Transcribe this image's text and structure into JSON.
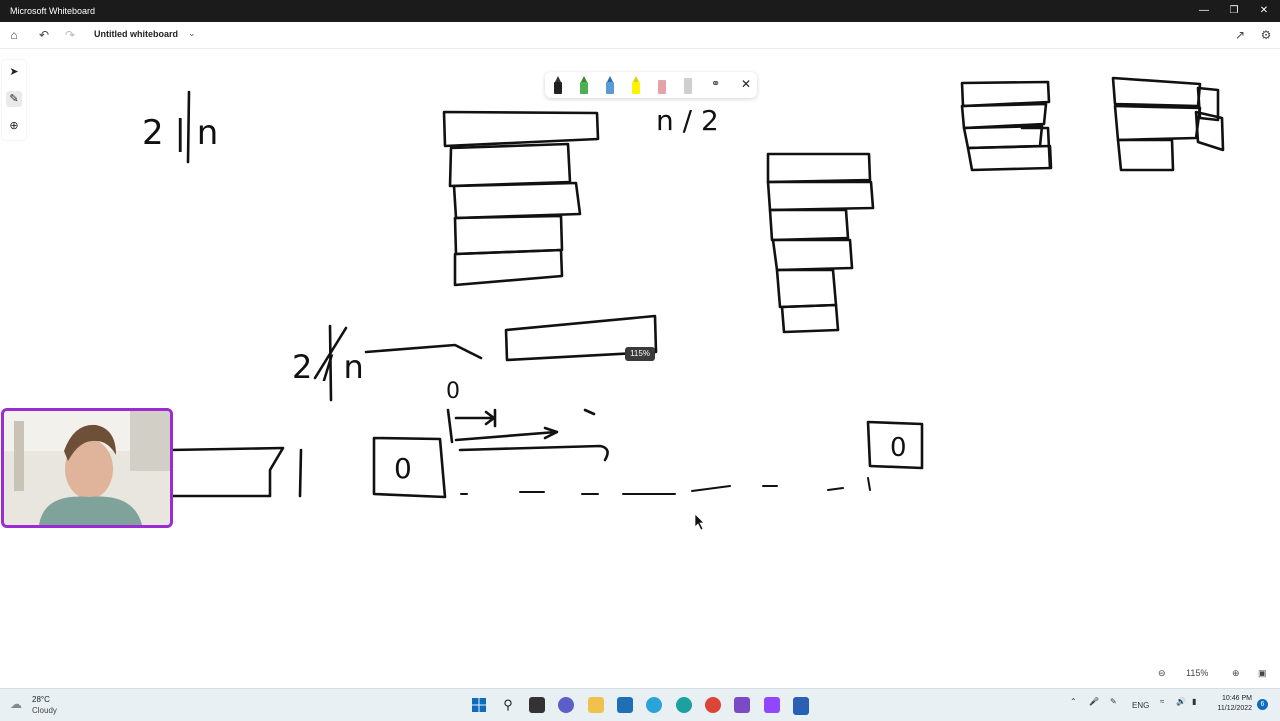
{
  "window": {
    "title": "Microsoft Whiteboard"
  },
  "appbar": {
    "doc_title": "Untitled whiteboard"
  },
  "canvas": {
    "zoom_pill": "115%",
    "handwriting": {
      "top_left": "2 | n",
      "top_center": "n / 2",
      "middle_left": "2 / n",
      "zero_small": "0",
      "box_left": "0",
      "box_right": "0",
      "bar_one": "1"
    }
  },
  "zoom_controls": {
    "zoom_value": "115%"
  },
  "taskbar": {
    "weather_temp": "28°C",
    "weather_cond": "Cloudy",
    "lang": "ENG",
    "time": "10:46 PM",
    "date": "11/12/2022",
    "notification_count": "6"
  }
}
